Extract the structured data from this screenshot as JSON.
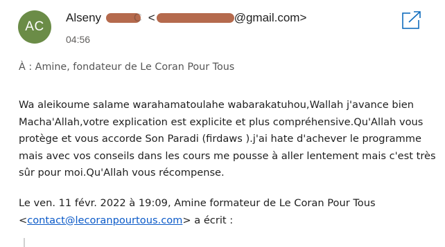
{
  "sender": {
    "initials": "AC",
    "name_visible": "Alseny",
    "name_trailing_fragment": "C",
    "email_open": "<",
    "email_suffix": "@gmail.com>",
    "time": "04:56"
  },
  "recipient": {
    "to_line": "À : Amine, fondateur de Le Coran Pour Tous"
  },
  "message": {
    "lines": [
      "Wa aleikoume salame warahamatoulahe wabarakatuhou,Wallah j'avance bien",
      "Macha'Allah,votre explication est explicite et plus compréhensive.Qu'Allah vous",
      "protège et vous accorde Son Paradi (firdaws ).j'ai hate d'achever le programme",
      "mais avec vos conseils dans les cours me pousse à aller lentement mais c'est très",
      "sûr pour moi.Qu'Allah vous récompense."
    ]
  },
  "quoted": {
    "intro": "Le ven. 11 févr. 2022 à 19:09, Amine formateur de Le Coran Pour Tous",
    "lt": "<",
    "email": "contact@lecoranpourtous.com",
    "after": "> a écrit :"
  },
  "icons": {
    "popout": "open-in-new-window-icon"
  },
  "colors": {
    "avatar_bg": "#6b8c47",
    "popout_icon": "#0f6cbd",
    "link": "#0b5ac8",
    "redaction": "#b56a4d"
  }
}
